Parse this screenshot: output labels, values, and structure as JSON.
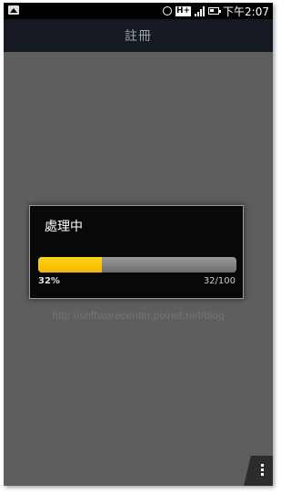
{
  "status_bar": {
    "time": "下午2:07",
    "network_label": "H+",
    "icons": [
      "image-icon",
      "alarm-icon",
      "network-icon",
      "signal-icon",
      "battery-icon"
    ]
  },
  "header": {
    "title": "註冊"
  },
  "dialog": {
    "title": "處理中",
    "progress_fraction": 0.32,
    "progress_percent_label": "32%",
    "progress_count_label": "32/100",
    "fill_color": "#ffc800"
  },
  "watermark": "http://softwarecenter.pixnet.net/blog",
  "overflow_menu": {
    "icon": "more-vert-icon"
  }
}
